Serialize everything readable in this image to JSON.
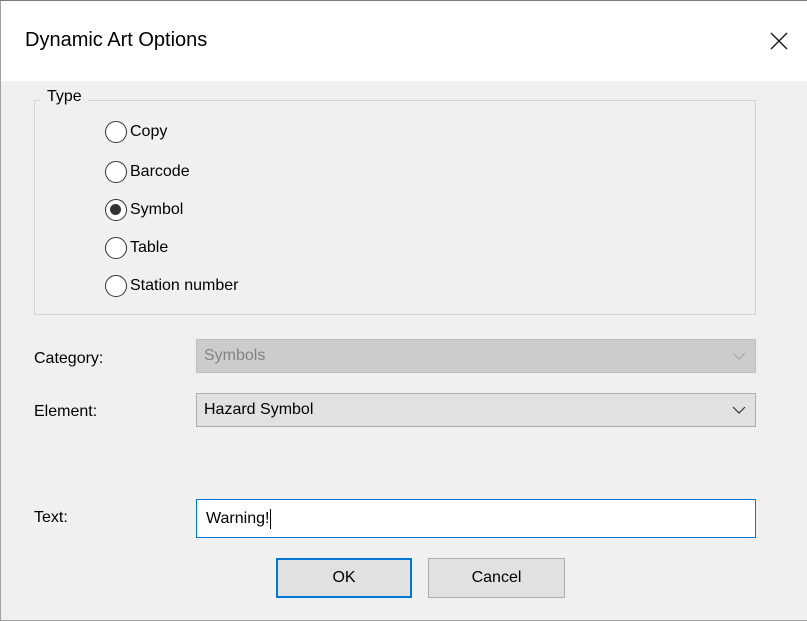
{
  "window": {
    "title": "Dynamic Art Options",
    "close_glyph": "✕"
  },
  "type_group": {
    "label": "Type",
    "options": [
      {
        "label": "Copy",
        "checked": false
      },
      {
        "label": "Barcode",
        "checked": false
      },
      {
        "label": "Symbol",
        "checked": true
      },
      {
        "label": "Table",
        "checked": false
      },
      {
        "label": "Station number",
        "checked": false
      }
    ]
  },
  "category": {
    "label": "Category:",
    "value": "Symbols",
    "enabled": false
  },
  "element": {
    "label": "Element:",
    "value": "Hazard Symbol",
    "enabled": true
  },
  "text": {
    "label": "Text:",
    "value": "Warning!"
  },
  "buttons": {
    "ok": "OK",
    "cancel": "Cancel"
  },
  "colors": {
    "accent": "#0078d7",
    "dialog_bg": "#f0f0f0",
    "button_bg": "#e1e1e1"
  }
}
